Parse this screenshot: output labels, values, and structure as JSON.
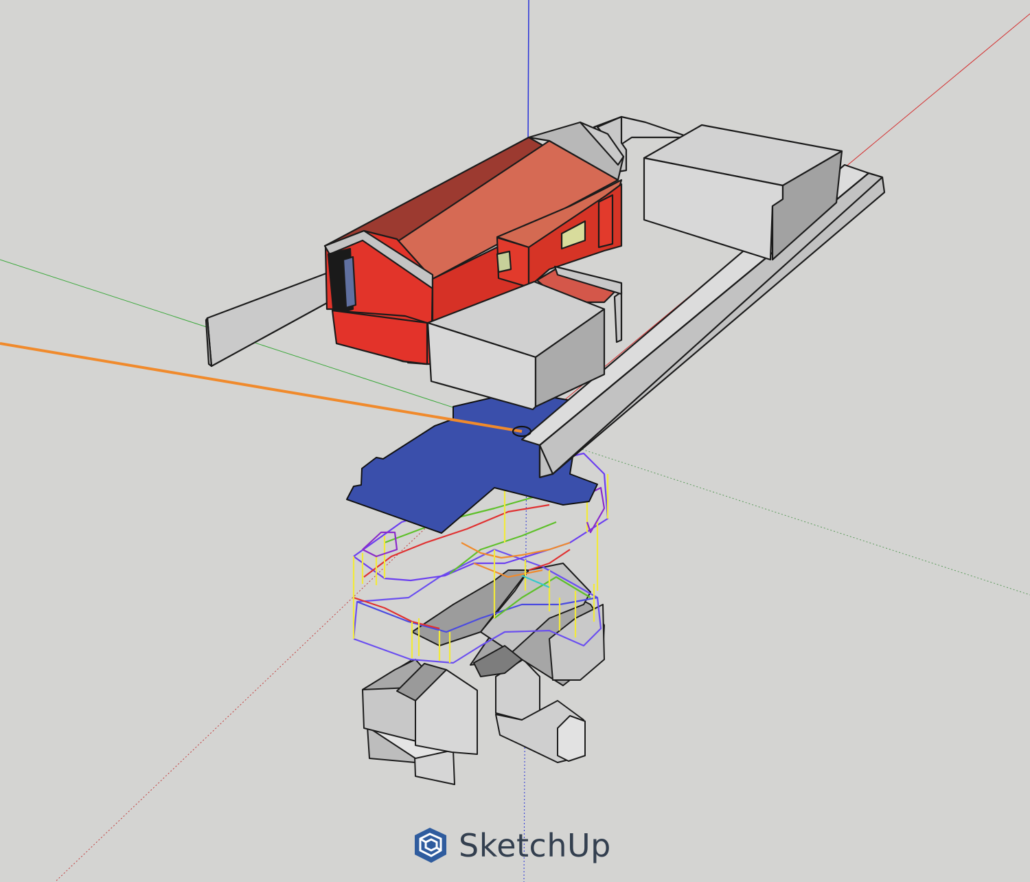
{
  "app": {
    "brand_name": "SketchUp",
    "brand_color": "#2f5c9e",
    "background_color": "#d4d4d2",
    "logo_icon": "sketchup-logo-icon"
  },
  "model": {
    "house_color": "#e2342a",
    "roof_color": "#d4574a",
    "floor_plan_color": "#3a4fab",
    "context_mass_color": "#c4c4c4",
    "selected_edge_color": "#f08a2c",
    "axis_colors": {
      "red": "#d42c2c",
      "green": "#3aa83a",
      "blue": "#2630d8"
    }
  }
}
